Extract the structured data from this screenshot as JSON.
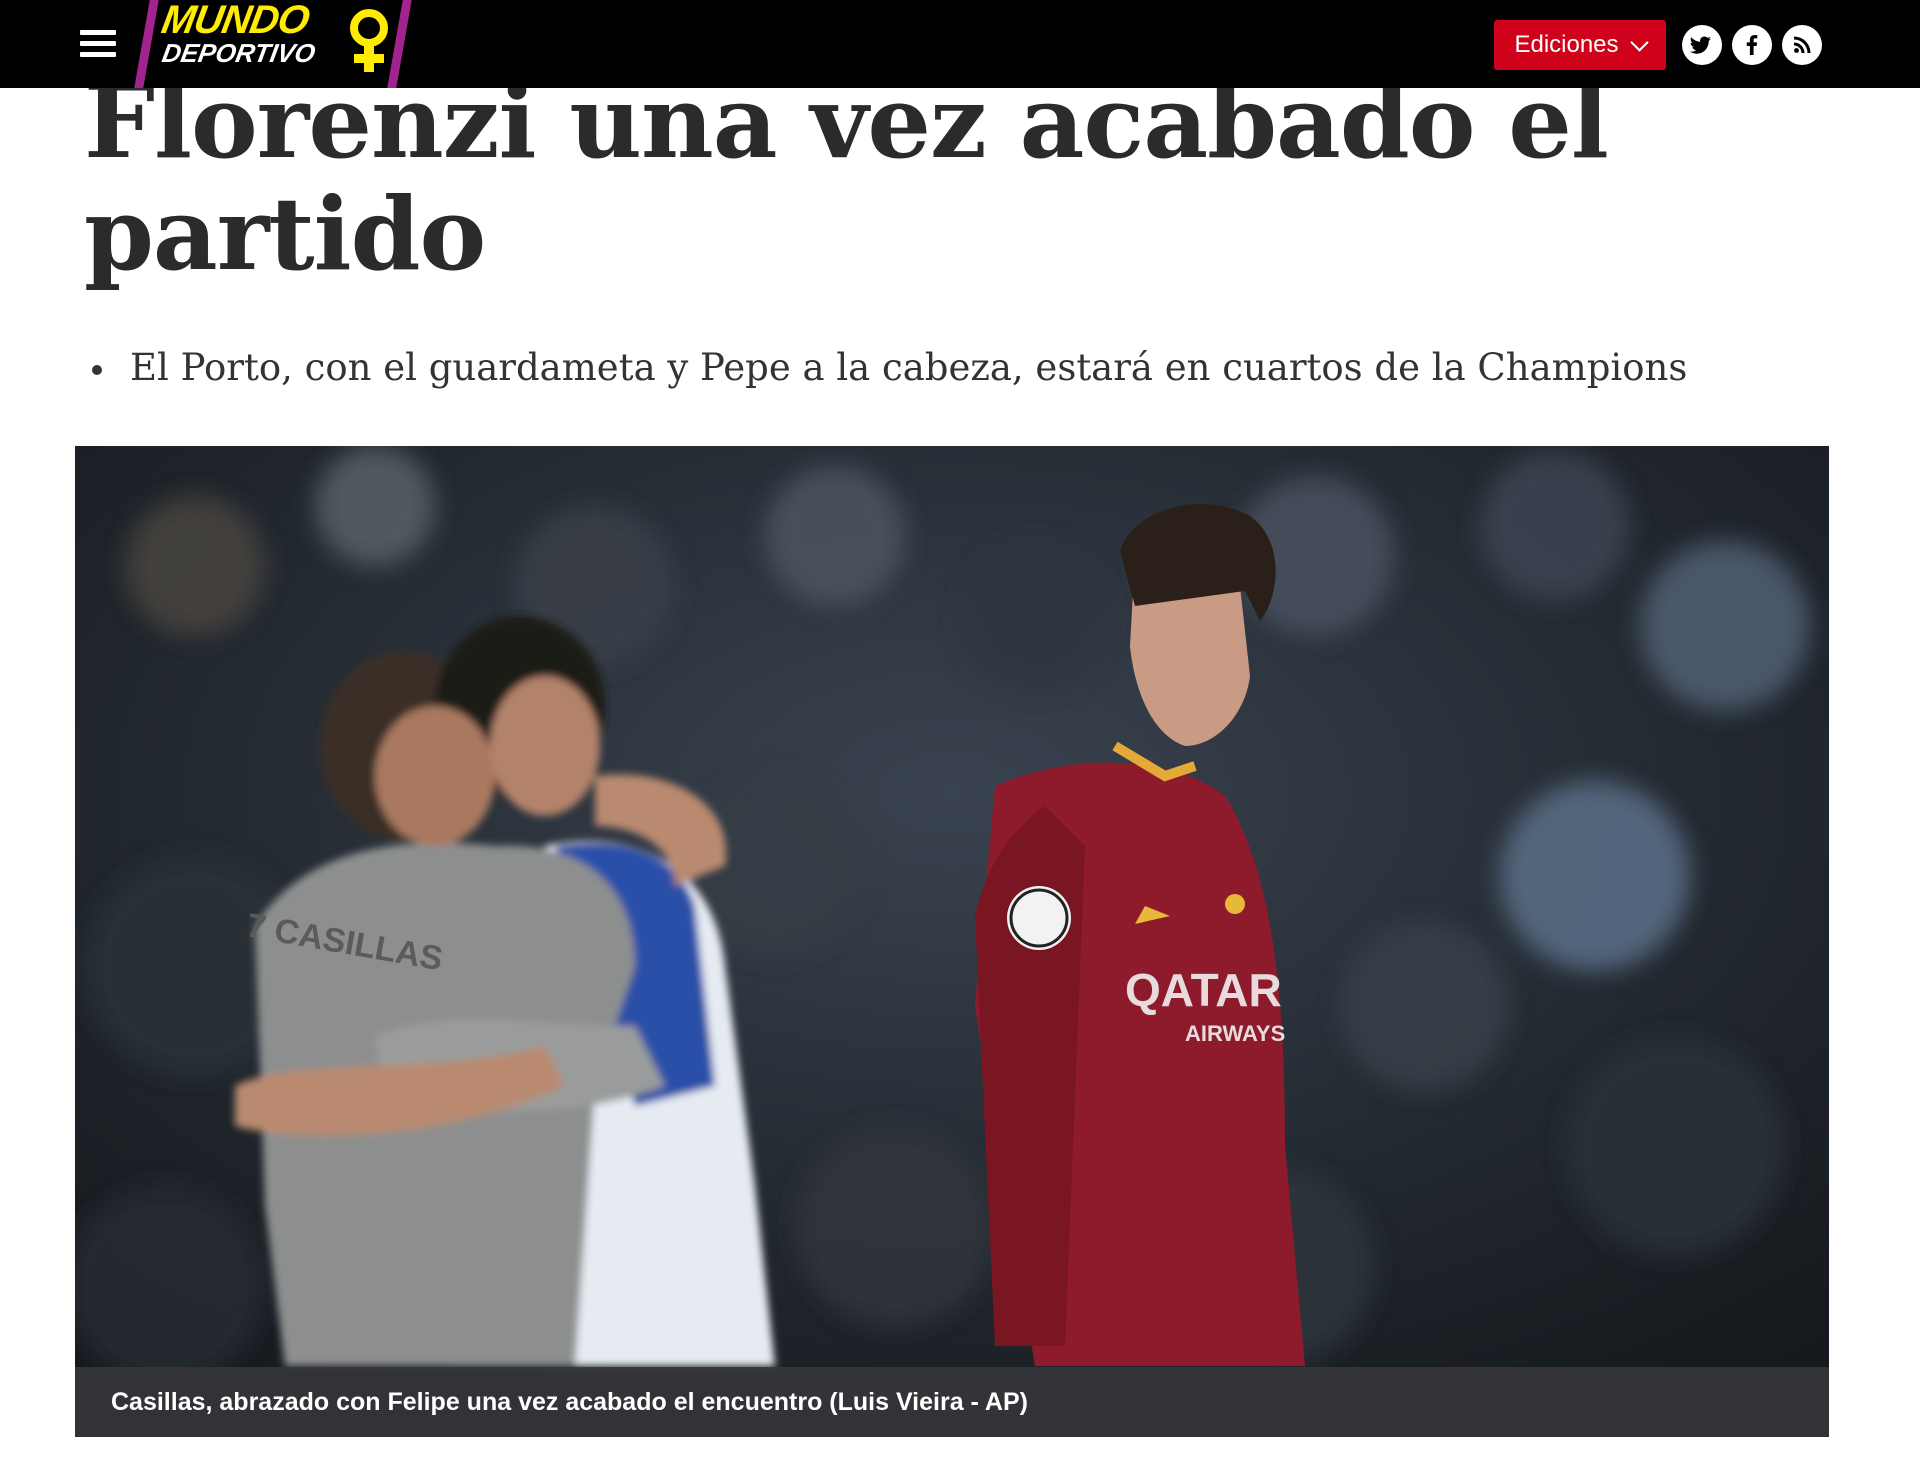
{
  "header": {
    "logo": {
      "line1": "MUNDO",
      "line2": "DEPORTIVO",
      "colors": {
        "yellow": "#ffec00",
        "magenta": "#a3238e"
      }
    },
    "editions_label": "Ediciones",
    "social_icons": [
      "twitter-icon",
      "facebook-icon",
      "rss-icon"
    ],
    "accent_color": "#d0021b"
  },
  "article": {
    "headline_line1": "Florenzi una vez acabado el",
    "headline_line2": "partido",
    "summary": [
      "El Porto, con el guardameta y Pepe a la cabeza, estará en cuartos de la Champions"
    ],
    "photo": {
      "caption": "Casillas, abrazado con Felipe una vez acabado el encuentro (Luis Vieira - AP)",
      "jersey_text": [
        "7 CASILLAS",
        "QATAR",
        "AIRWAYS"
      ]
    }
  }
}
